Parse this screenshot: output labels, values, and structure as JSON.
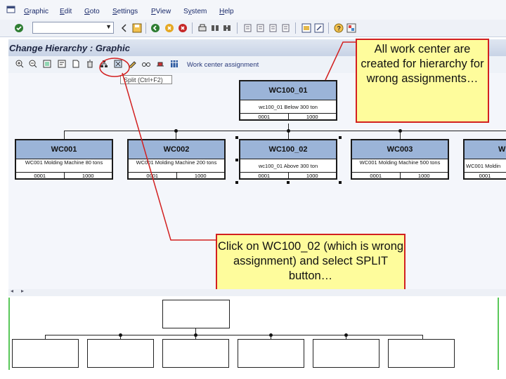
{
  "menu": {
    "items": [
      "Graphic",
      "Edit",
      "Goto",
      "Settings",
      "PView",
      "System",
      "Help"
    ],
    "underline": [
      "G",
      "E",
      "G",
      "S",
      "P",
      "y",
      "H"
    ]
  },
  "title": "Change Hierarchy : Graphic",
  "apptoolbar": {
    "work_center_assignment": "Work center assignment"
  },
  "tooltip": "Split   (Ctrl+F2)",
  "root": {
    "name": "WC100_01",
    "desc": "wc100_01 Below 300 ton",
    "c1": "0001",
    "c2": "1000"
  },
  "nodes": [
    {
      "name": "WC001",
      "desc": "WC001 Molding Machine 80 tons",
      "c1": "0001",
      "c2": "1000"
    },
    {
      "name": "WC002",
      "desc": "WC001 Molding Machine 200 tons",
      "c1": "0001",
      "c2": "1000"
    },
    {
      "name": "WC100_02",
      "desc": "wc100_01 Above 300 ton",
      "c1": "0001",
      "c2": "1000"
    },
    {
      "name": "WC003",
      "desc": "WC001 Molding Machine 500 tons",
      "c1": "0001",
      "c2": "1000"
    },
    {
      "name": "W",
      "desc": "WC001 Moldin",
      "c1": "0001",
      "c2": ""
    }
  ],
  "callouts": {
    "top": "All work center are created for hierarchy for wrong assignments…",
    "mid": "Click on WC100_02 (which is wrong assignment) and select SPLIT button…"
  },
  "icons": [
    "enter-icon",
    "back-icon",
    "save-icon",
    "exit-icon",
    "cancel-icon",
    "print-icon",
    "find-icon",
    "find-next-icon",
    "first-page-icon",
    "prev-page-icon",
    "next-page-icon",
    "last-page-icon",
    "create-session-icon",
    "shortcut-icon",
    "help-icon",
    "layout-icon",
    "zoom-in-icon",
    "zoom-out-icon",
    "split-icon",
    "edit-icon"
  ]
}
